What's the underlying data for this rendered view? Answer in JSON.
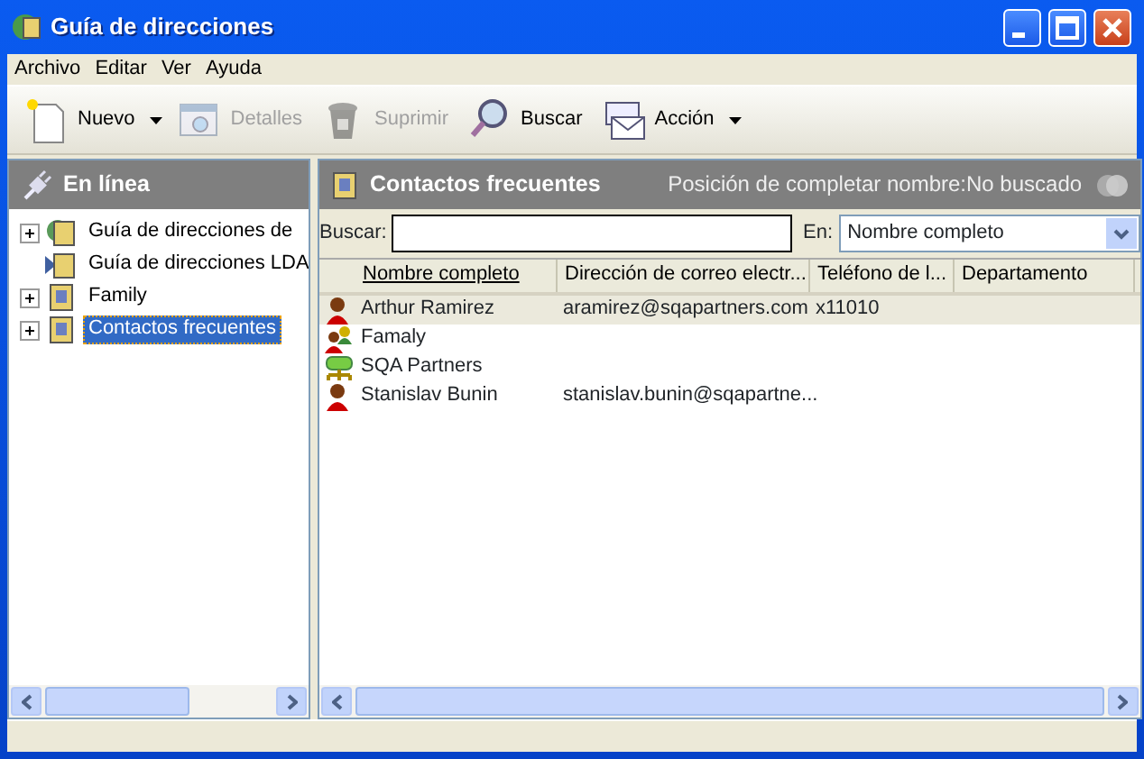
{
  "window": {
    "title": "Guía de direcciones"
  },
  "menu": [
    {
      "label": "Archivo"
    },
    {
      "label": "Editar"
    },
    {
      "label": "Ver"
    },
    {
      "label": "Ayuda"
    }
  ],
  "toolbar": [
    {
      "kind": "new",
      "label": "Nuevo",
      "disabled": false,
      "dropdown": true
    },
    {
      "kind": "details",
      "label": "Detalles",
      "disabled": true,
      "dropdown": false
    },
    {
      "kind": "delete",
      "label": "Suprimir",
      "disabled": true,
      "dropdown": false
    },
    {
      "kind": "search",
      "label": "Buscar",
      "disabled": false,
      "dropdown": false
    },
    {
      "kind": "action",
      "label": "Acción",
      "disabled": false,
      "dropdown": true
    }
  ],
  "left_pane": {
    "header": "En línea",
    "tree": [
      {
        "kind": "global",
        "label": "Guía de direcciones de",
        "expandable": true,
        "selected": false
      },
      {
        "kind": "ldap",
        "label": "Guía de direcciones LDA",
        "expandable": false,
        "selected": false
      },
      {
        "kind": "book",
        "label": "Family",
        "expandable": true,
        "selected": false
      },
      {
        "kind": "book",
        "label": "Contactos frecuentes",
        "expandable": true,
        "selected": true
      }
    ]
  },
  "right_pane": {
    "header": "Contactos frecuentes",
    "status": "Posición de completar nombre:No buscado",
    "search": {
      "label": "Buscar:"
    },
    "search_in": {
      "label": "En:",
      "value": "Nombre completo"
    },
    "table": {
      "columns": [
        {
          "label": "Nombre completo",
          "sorted": true
        },
        {
          "label": "Dirección de correo electr...",
          "sorted": false
        },
        {
          "label": "Teléfono de l...",
          "sorted": false
        },
        {
          "label": "Departamento",
          "sorted": false
        }
      ],
      "rows": [
        {
          "kind": "person",
          "selected": true,
          "cells": [
            "Arthur Ramirez",
            "aramirez@sqapartners.com",
            "x11010",
            ""
          ]
        },
        {
          "kind": "group",
          "selected": false,
          "cells": [
            "Famaly",
            "",
            "",
            ""
          ]
        },
        {
          "kind": "org",
          "selected": false,
          "cells": [
            "SQA Partners",
            "",
            "",
            ""
          ]
        },
        {
          "kind": "person",
          "selected": false,
          "cells": [
            "Stanislav Bunin",
            "stanislav.bunin@sqapartne...",
            "",
            ""
          ]
        }
      ]
    }
  }
}
